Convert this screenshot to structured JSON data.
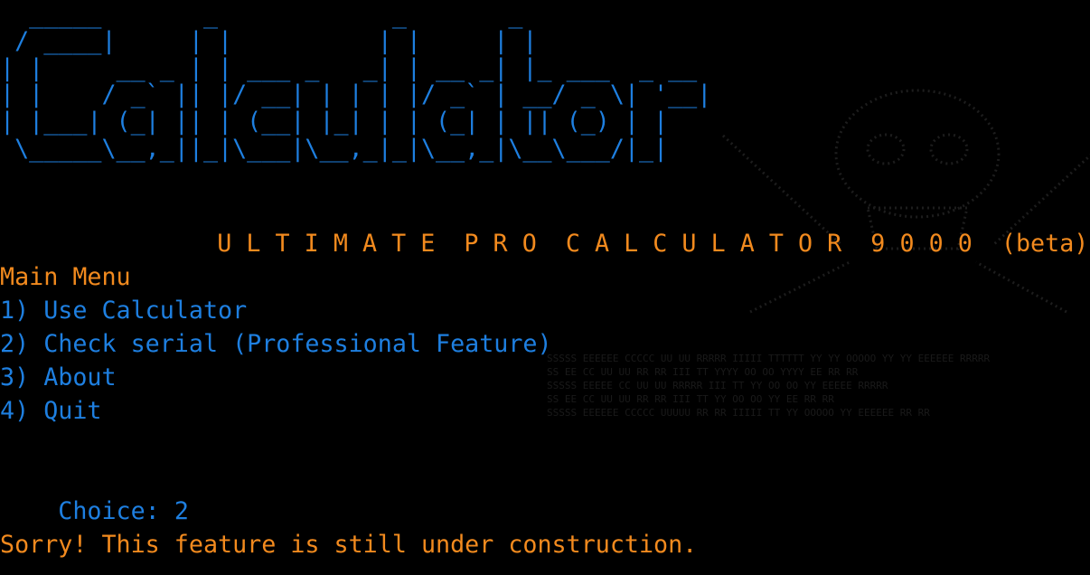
{
  "banner": {
    "lines": [
      "  _____       _            _       _",
      " / ____|     | |          | |     | |",
      "| |     __ _ | | ___ _   _| | __ _| |_ ___  _ __",
      "| |    / _` || |/ __| | | | |/ _` | __/ _ \\| '__|",
      "| |___| (_| || | (__| |_| | | (_| | || (_) | |",
      " \\_____\\__,_||_|\\___|\\__,_|_|\\__,_|\\__\\___/|_|"
    ],
    "subtitle": "U L T I M A T E  P R O  C A L C U L A T O R  9 0 0 0",
    "beta": "(beta)"
  },
  "menu": {
    "title": "Main Menu",
    "items": [
      "1) Use Calculator",
      "2) Check serial (Professional Feature)",
      "3) About",
      "4) Quit"
    ]
  },
  "prompt": {
    "label": "Choice:",
    "value": "2"
  },
  "message": "Sorry! This feature is still under construction.",
  "colors": {
    "background": "#000000",
    "accent_orange": "#f28a1e",
    "accent_blue": "#1e7fe0",
    "watermark": "#3a3a3a"
  },
  "icons": {
    "watermark": "skull-and-crossbones-icon"
  }
}
